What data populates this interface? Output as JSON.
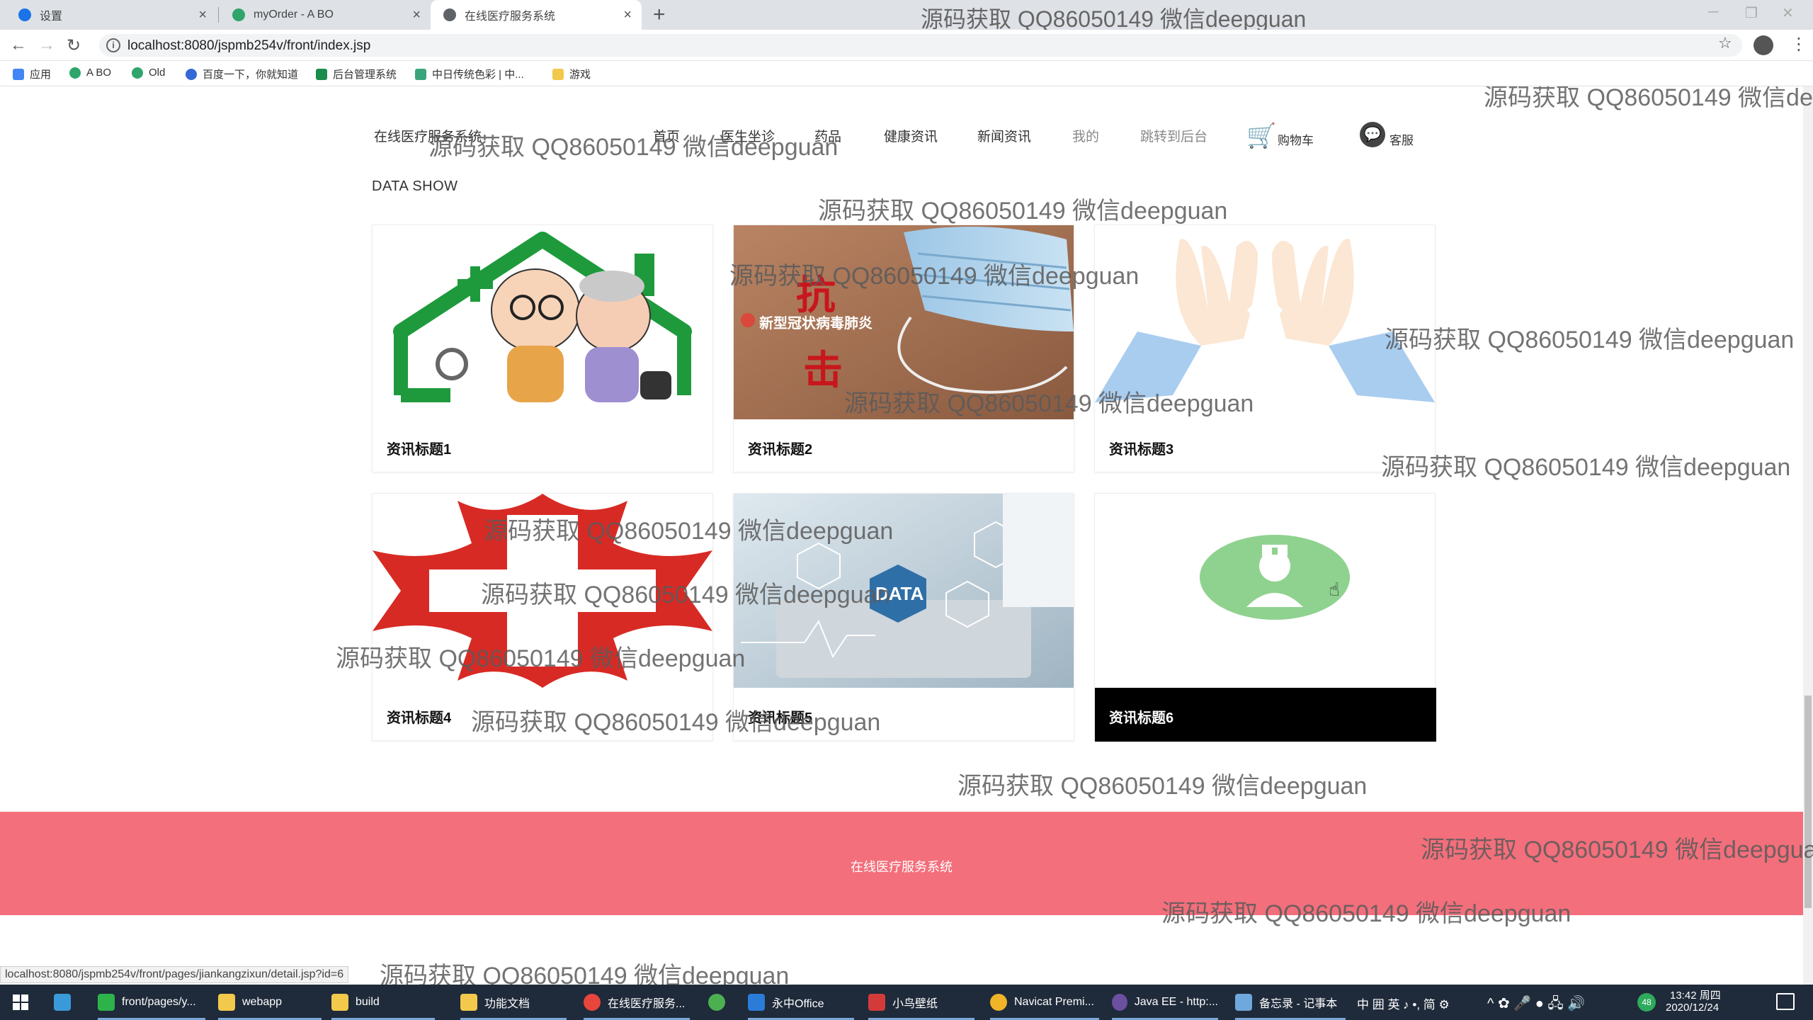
{
  "browser": {
    "tabs": [
      {
        "title": "设置",
        "active": false
      },
      {
        "title": "myOrder - A BO",
        "active": false
      },
      {
        "title": "在线医疗服务系统",
        "active": true
      }
    ],
    "new_tab": "+",
    "address": "localhost:8080/jspmb254v/front/index.jsp",
    "bookmarks": [
      "应用",
      "A BO",
      "Old",
      "百度一下，你就知道",
      "后台管理系统",
      "中日传统色彩 | 中...",
      "游戏"
    ]
  },
  "site": {
    "nav": {
      "brand": "在线医疗服务系统",
      "items": [
        "首页",
        "医生坐诊",
        "药品",
        "健康资讯",
        "新闻资讯",
        "我的",
        "跳转到后台"
      ],
      "cart": "购物车",
      "service": "客服"
    },
    "section_title": "DATA SHOW",
    "cards": [
      {
        "title": "资讯标题1"
      },
      {
        "title": "资讯标题2"
      },
      {
        "title": "资讯标题3"
      },
      {
        "title": "资讯标题4"
      },
      {
        "title": "资讯标题5"
      },
      {
        "title": "资讯标题6",
        "highlight": true
      }
    ],
    "image_texts": {
      "fight_1": "抗",
      "fight_2": "击",
      "covid": "新型冠状病毒肺炎",
      "data": "DATA"
    },
    "footer": "在线医疗服务系统"
  },
  "status_bar_url": "localhost:8080/jspmb254v/front/pages/jiankangzixun/detail.jsp?id=6",
  "watermark": "源码获取 QQ86050149 微信deepguan",
  "taskbar": {
    "items": [
      "front/pages/y...",
      "webapp",
      "build",
      "功能文档",
      "在线医疗服务...",
      "",
      "永中Office",
      "小鸟壁纸",
      "Navicat Premi...",
      "Java EE - http:...",
      "备忘录 - 记事本"
    ],
    "tray": "中 囲 英 ♪ •, 简 ⚙",
    "time": "13:42 周四",
    "date": "2020/12/24"
  },
  "colors": {
    "footer_bg": "#f36f7b",
    "highlight_card": "#000000",
    "nurse_circle": "#8fd28f"
  }
}
